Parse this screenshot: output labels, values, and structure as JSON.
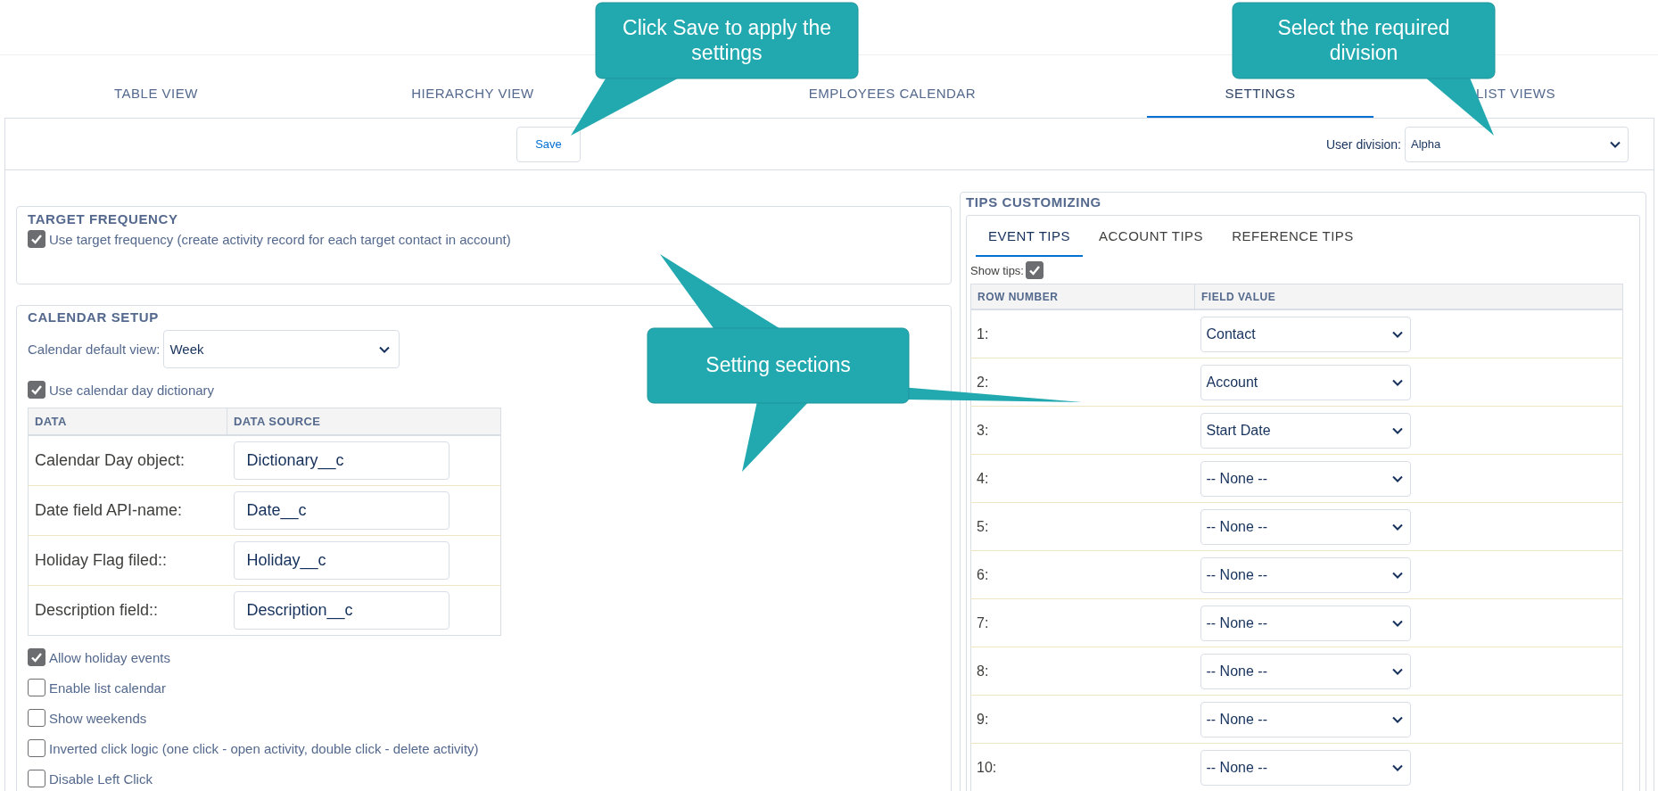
{
  "tabs": [
    {
      "label": "TABLE VIEW",
      "selected": false
    },
    {
      "label": "HIERARCHY VIEW",
      "selected": false
    },
    {
      "label": "EMPLOYEES CALENDAR",
      "selected": false
    },
    {
      "label": "SETTINGS",
      "selected": true
    },
    {
      "label": "LIST VIEWS",
      "selected": false
    }
  ],
  "toolbar": {
    "save_button": "Save",
    "division_label": "User division:",
    "division_value": "Alpha"
  },
  "target_frequency": {
    "title": "TARGET FREQUENCY",
    "options": [
      {
        "label": "Use target frequency (create activity record for each target contact in account)",
        "checked": true
      }
    ]
  },
  "calendar_setup": {
    "title": "CALENDAR SETUP",
    "default_view_label": "Calendar default view:",
    "default_view_value": "Week",
    "dictionary_option": {
      "label": "Use calendar day dictionary",
      "checked": true
    },
    "table": {
      "columns": [
        "DATA",
        "DATA SOURCE"
      ],
      "rows": [
        {
          "label": "Calendar Day object:",
          "value": "Dictionary__c"
        },
        {
          "label": "Date field API-name:",
          "value": "Date__c"
        },
        {
          "label": "Holiday Flag filed::",
          "value": "Holiday__c"
        },
        {
          "label": "Description field::",
          "value": "Description__c"
        }
      ]
    },
    "options": [
      {
        "label": "Allow holiday events",
        "checked": true
      },
      {
        "label": "Enable list calendar",
        "checked": false
      },
      {
        "label": "Show weekends",
        "checked": false
      },
      {
        "label": "Inverted click logic (one click - open activity, double click - delete activity)",
        "checked": false
      },
      {
        "label": "Disable Left Click",
        "checked": false
      }
    ]
  },
  "tips": {
    "title": "TIPS CUSTOMIZING",
    "tabs": [
      {
        "label": "EVENT TIPS",
        "selected": true
      },
      {
        "label": "ACCOUNT TIPS",
        "selected": false
      },
      {
        "label": "REFERENCE TIPS",
        "selected": false
      }
    ],
    "show_tips": {
      "label": "Show tips:",
      "checked": true
    },
    "table": {
      "columns": [
        "ROW NUMBER",
        "FIELD VALUE"
      ],
      "rows": [
        {
          "number": "1:",
          "value": "Contact"
        },
        {
          "number": "2:",
          "value": "Account"
        },
        {
          "number": "3:",
          "value": "Start Date"
        },
        {
          "number": "4:",
          "value": "-- None --"
        },
        {
          "number": "5:",
          "value": "-- None --"
        },
        {
          "number": "6:",
          "value": "-- None --"
        },
        {
          "number": "7:",
          "value": "-- None --"
        },
        {
          "number": "8:",
          "value": "-- None --"
        },
        {
          "number": "9:",
          "value": "-- None --"
        },
        {
          "number": "10:",
          "value": "-- None --"
        }
      ]
    }
  },
  "callouts": [
    {
      "text": "Click Save to apply the settings"
    },
    {
      "text": "Select the required division"
    },
    {
      "text": "Setting sections"
    }
  ]
}
